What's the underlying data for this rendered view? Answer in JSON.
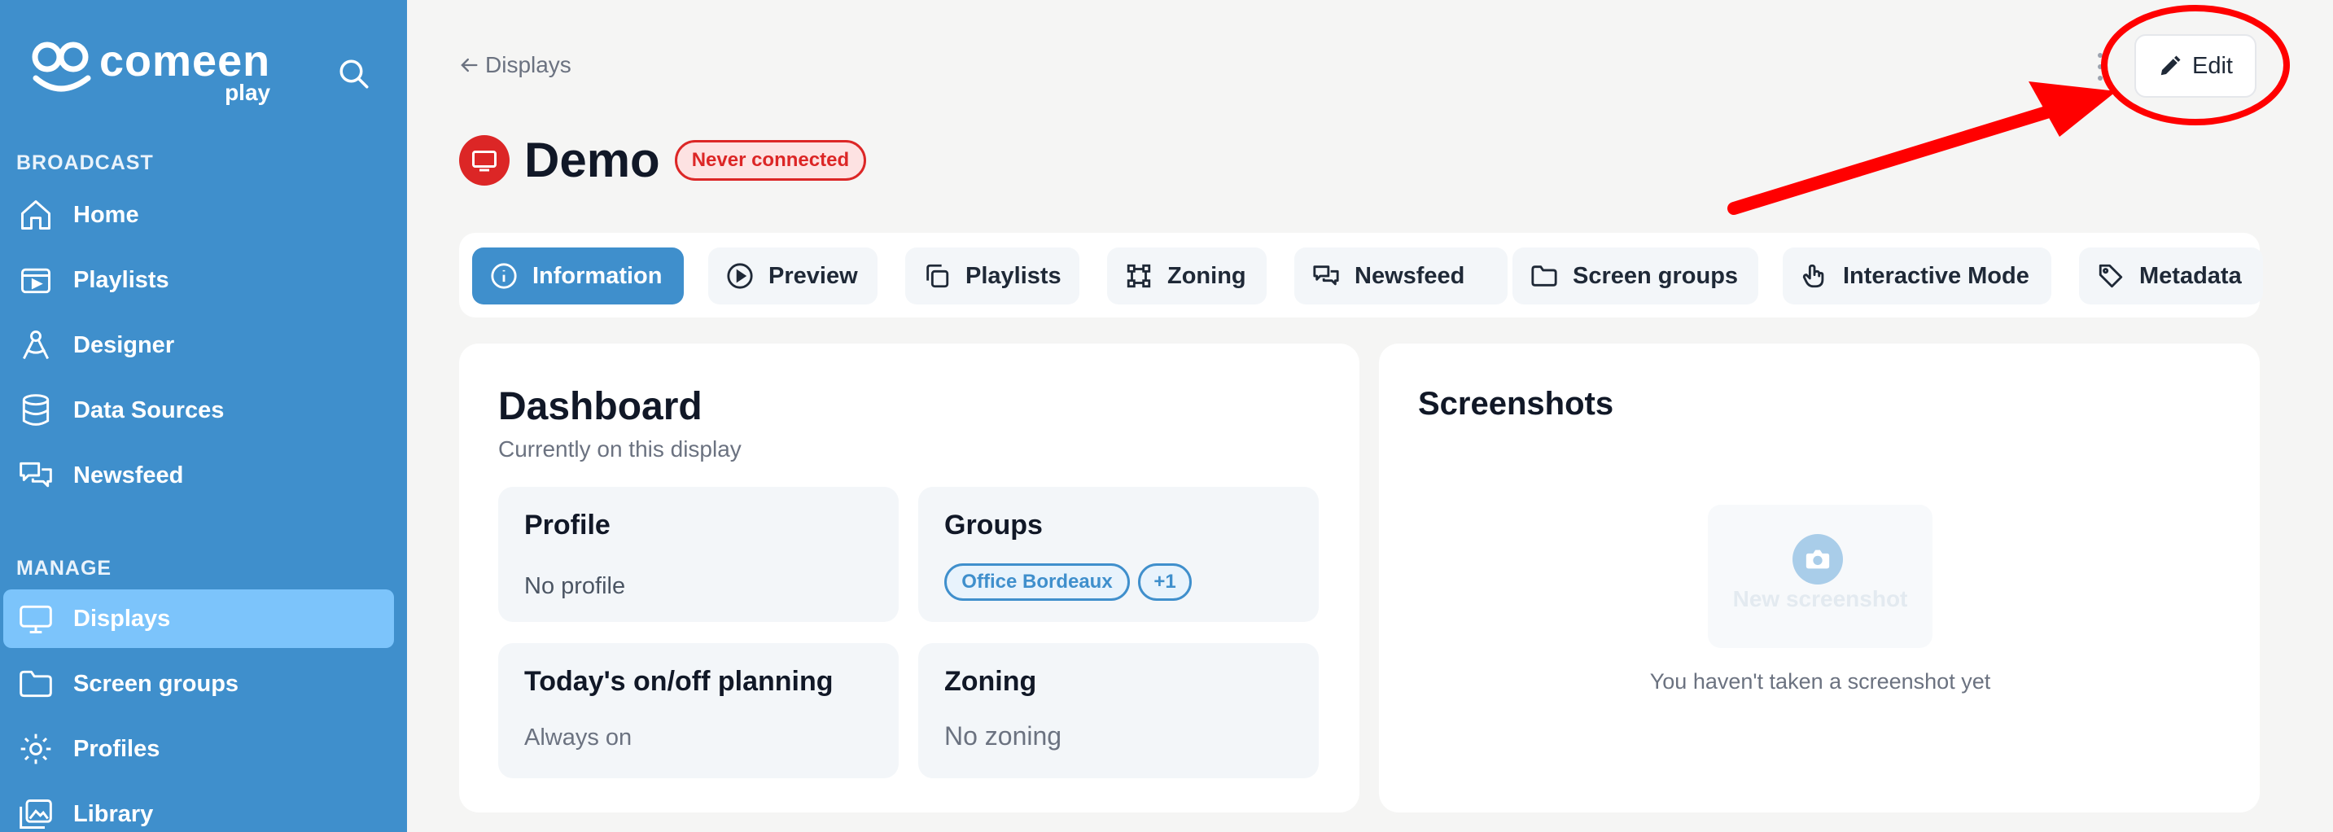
{
  "app": {
    "logo_word": "comeen",
    "logo_sub": "play"
  },
  "sidebar": {
    "sections": [
      {
        "title": "BROADCAST",
        "items": [
          {
            "label": "Home",
            "icon": "home-icon"
          },
          {
            "label": "Playlists",
            "icon": "playlist-icon"
          },
          {
            "label": "Designer",
            "icon": "designer-icon"
          },
          {
            "label": "Data Sources",
            "icon": "database-icon"
          },
          {
            "label": "Newsfeed",
            "icon": "chat-icon"
          }
        ]
      },
      {
        "title": "MANAGE",
        "items": [
          {
            "label": "Displays",
            "icon": "monitor-icon",
            "active": true
          },
          {
            "label": "Screen groups",
            "icon": "folder-icon"
          },
          {
            "label": "Profiles",
            "icon": "gear-icon"
          },
          {
            "label": "Library",
            "icon": "images-icon"
          }
        ]
      }
    ]
  },
  "header": {
    "back_label": "Displays",
    "edit_label": "Edit"
  },
  "display": {
    "name": "Demo",
    "status": "Never connected"
  },
  "tabs": [
    {
      "label": "Information",
      "icon": "info-icon",
      "active": true
    },
    {
      "label": "Preview",
      "icon": "play-icon"
    },
    {
      "label": "Playlists",
      "icon": "copy-icon"
    },
    {
      "label": "Zoning",
      "icon": "crop-icon"
    },
    {
      "label": "Newsfeed",
      "icon": "chat-icon"
    },
    {
      "label": "Screen groups",
      "icon": "folder-icon"
    },
    {
      "label": "Interactive Mode",
      "icon": "hand-icon"
    },
    {
      "label": "Metadata",
      "icon": "tag-icon"
    }
  ],
  "dashboard": {
    "title": "Dashboard",
    "subtitle": "Currently on this display",
    "profile": {
      "title": "Profile",
      "value": "No profile"
    },
    "groups": {
      "title": "Groups",
      "chips": [
        "Office Bordeaux",
        "+1"
      ]
    },
    "planning": {
      "title": "Today's on/off planning",
      "value": "Always on"
    },
    "zoning": {
      "title": "Zoning",
      "value": "No zoning"
    }
  },
  "screenshots": {
    "title": "Screenshots",
    "new_label": "New screenshot",
    "empty_text": "You haven't taken a screenshot yet"
  },
  "colors": {
    "sidebar": "#3f8fcc",
    "active_item": "#7cc4fb",
    "status_red": "#dc2626",
    "annotation_red": "#ff0000"
  }
}
